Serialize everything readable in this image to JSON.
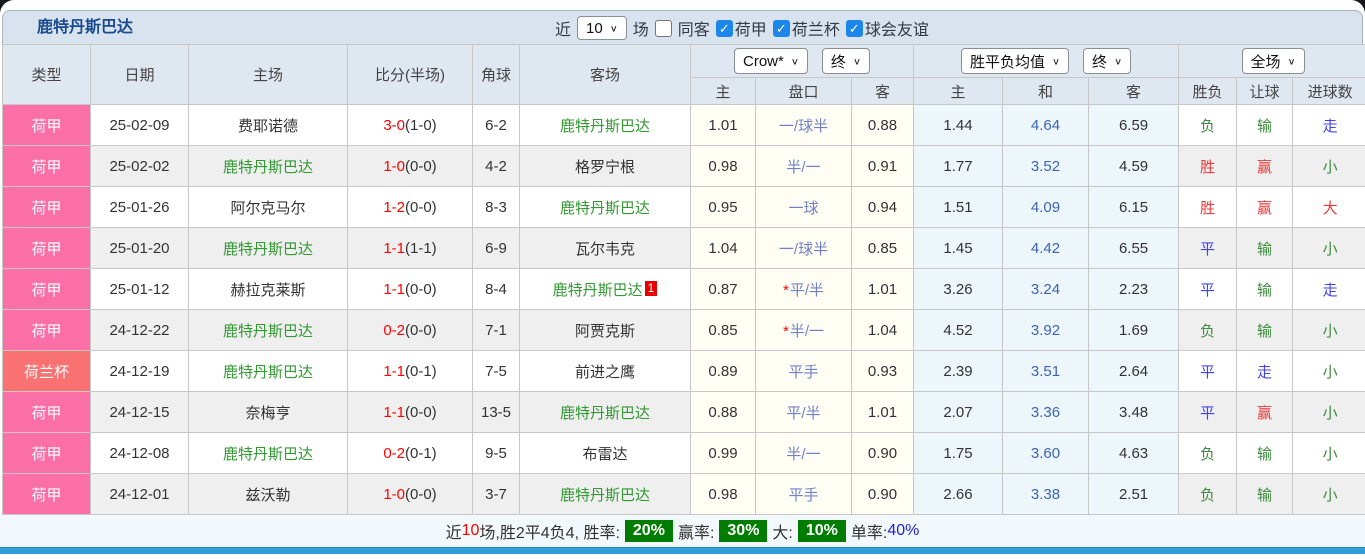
{
  "title": "鹿特丹斯巴达",
  "colors": {
    "league_cell": "#fa6fa5",
    "cup_cell": "#fa7171",
    "target_team_green": "#339933",
    "score_red": "#ff0000",
    "handicap_blue": "#7280c8",
    "avg_draw_blue": "#3c64b4",
    "win_red": "#e73b3b",
    "draw_blue": "#4343ee",
    "lose_green": "#3d8b3d",
    "badge_green": "#007d00",
    "bottom_bar_blue": "#2c9ed8",
    "header_bg": "#dfe7f0"
  },
  "controls": {
    "recent_label": "近",
    "recent_value": "10",
    "matches_label": "场",
    "same_venue_label": "同客",
    "same_venue_checked": false,
    "leagues": [
      {
        "label": "荷甲",
        "checked": true
      },
      {
        "label": "荷兰杯",
        "checked": true
      },
      {
        "label": "球会友谊",
        "checked": true
      }
    ]
  },
  "header": {
    "cols": [
      "类型",
      "日期",
      "主场",
      "比分(半场)",
      "角球",
      "客场"
    ],
    "odds_company_select": "Crow*",
    "odds_time_select": "终",
    "avg_select": "胜平负均值",
    "avg_time_select": "终",
    "period_select": "全场",
    "sub_cols": [
      "主",
      "盘口",
      "客",
      "主",
      "和",
      "客",
      "胜负",
      "让球",
      "进球数"
    ]
  },
  "rows": [
    {
      "league": "荷甲",
      "cup": false,
      "date": "25-02-09",
      "home": "费耶诺德",
      "home_target": false,
      "score": "3-0",
      "half": "(1-0)",
      "corners": "6-2",
      "away": "鹿特丹斯巴达",
      "away_target": true,
      "badge": null,
      "odds_home": "1.01",
      "handicap": "一/球半",
      "star": false,
      "odds_away": "0.88",
      "avg_home": "1.44",
      "avg_draw": "4.64",
      "avg_away": "6.59",
      "result": [
        "负",
        "green"
      ],
      "give": [
        "输",
        "green"
      ],
      "goals": [
        "走",
        "blue"
      ]
    },
    {
      "league": "荷甲",
      "cup": false,
      "date": "25-02-02",
      "home": "鹿特丹斯巴达",
      "home_target": true,
      "score": "1-0",
      "half": "(0-0)",
      "corners": "4-2",
      "away": "格罗宁根",
      "away_target": false,
      "badge": null,
      "odds_home": "0.98",
      "handicap": "半/一",
      "star": false,
      "odds_away": "0.91",
      "avg_home": "1.77",
      "avg_draw": "3.52",
      "avg_away": "4.59",
      "result": [
        "胜",
        "red"
      ],
      "give": [
        "赢",
        "red"
      ],
      "goals": [
        "小",
        "green"
      ]
    },
    {
      "league": "荷甲",
      "cup": false,
      "date": "25-01-26",
      "home": "阿尔克马尔",
      "home_target": false,
      "score": "1-2",
      "half": "(0-0)",
      "corners": "8-3",
      "away": "鹿特丹斯巴达",
      "away_target": true,
      "badge": null,
      "odds_home": "0.95",
      "handicap": "一球",
      "star": false,
      "odds_away": "0.94",
      "avg_home": "1.51",
      "avg_draw": "4.09",
      "avg_away": "6.15",
      "result": [
        "胜",
        "red"
      ],
      "give": [
        "赢",
        "red"
      ],
      "goals": [
        "大",
        "red"
      ]
    },
    {
      "league": "荷甲",
      "cup": false,
      "date": "25-01-20",
      "home": "鹿特丹斯巴达",
      "home_target": true,
      "score": "1-1",
      "half": "(1-1)",
      "corners": "6-9",
      "away": "瓦尔韦克",
      "away_target": false,
      "badge": null,
      "odds_home": "1.04",
      "handicap": "一/球半",
      "star": false,
      "odds_away": "0.85",
      "avg_home": "1.45",
      "avg_draw": "4.42",
      "avg_away": "6.55",
      "result": [
        "平",
        "blue"
      ],
      "give": [
        "输",
        "green"
      ],
      "goals": [
        "小",
        "green"
      ]
    },
    {
      "league": "荷甲",
      "cup": false,
      "date": "25-01-12",
      "home": "赫拉克莱斯",
      "home_target": false,
      "score": "1-1",
      "half": "(0-0)",
      "corners": "8-4",
      "away": "鹿特丹斯巴达",
      "away_target": true,
      "badge": "1",
      "odds_home": "0.87",
      "handicap": "平/半",
      "star": true,
      "odds_away": "1.01",
      "avg_home": "3.26",
      "avg_draw": "3.24",
      "avg_away": "2.23",
      "result": [
        "平",
        "blue"
      ],
      "give": [
        "输",
        "green"
      ],
      "goals": [
        "走",
        "blue"
      ]
    },
    {
      "league": "荷甲",
      "cup": false,
      "date": "24-12-22",
      "home": "鹿特丹斯巴达",
      "home_target": true,
      "score": "0-2",
      "half": "(0-0)",
      "corners": "7-1",
      "away": "阿贾克斯",
      "away_target": false,
      "badge": null,
      "odds_home": "0.85",
      "handicap": "半/一",
      "star": true,
      "odds_away": "1.04",
      "avg_home": "4.52",
      "avg_draw": "3.92",
      "avg_away": "1.69",
      "result": [
        "负",
        "green"
      ],
      "give": [
        "输",
        "green"
      ],
      "goals": [
        "小",
        "green"
      ]
    },
    {
      "league": "荷兰杯",
      "cup": true,
      "date": "24-12-19",
      "home": "鹿特丹斯巴达",
      "home_target": true,
      "score": "1-1",
      "half": "(0-1)",
      "corners": "7-5",
      "away": "前进之鹰",
      "away_target": false,
      "badge": null,
      "odds_home": "0.89",
      "handicap": "平手",
      "star": false,
      "odds_away": "0.93",
      "avg_home": "2.39",
      "avg_draw": "3.51",
      "avg_away": "2.64",
      "result": [
        "平",
        "blue"
      ],
      "give": [
        "走",
        "blue"
      ],
      "goals": [
        "小",
        "green"
      ]
    },
    {
      "league": "荷甲",
      "cup": false,
      "date": "24-12-15",
      "home": "奈梅亨",
      "home_target": false,
      "score": "1-1",
      "half": "(0-0)",
      "corners": "13-5",
      "away": "鹿特丹斯巴达",
      "away_target": true,
      "badge": null,
      "odds_home": "0.88",
      "handicap": "平/半",
      "star": false,
      "odds_away": "1.01",
      "avg_home": "2.07",
      "avg_draw": "3.36",
      "avg_away": "3.48",
      "result": [
        "平",
        "blue"
      ],
      "give": [
        "赢",
        "red"
      ],
      "goals": [
        "小",
        "green"
      ]
    },
    {
      "league": "荷甲",
      "cup": false,
      "date": "24-12-08",
      "home": "鹿特丹斯巴达",
      "home_target": true,
      "score": "0-2",
      "half": "(0-1)",
      "corners": "9-5",
      "away": "布雷达",
      "away_target": false,
      "badge": null,
      "odds_home": "0.99",
      "handicap": "半/一",
      "star": false,
      "odds_away": "0.90",
      "avg_home": "1.75",
      "avg_draw": "3.60",
      "avg_away": "4.63",
      "result": [
        "负",
        "green"
      ],
      "give": [
        "输",
        "green"
      ],
      "goals": [
        "小",
        "green"
      ]
    },
    {
      "league": "荷甲",
      "cup": false,
      "date": "24-12-01",
      "home": "兹沃勒",
      "home_target": false,
      "score": "1-0",
      "half": "(0-0)",
      "corners": "3-7",
      "away": "鹿特丹斯巴达",
      "away_target": true,
      "badge": null,
      "odds_home": "0.98",
      "handicap": "平手",
      "star": false,
      "odds_away": "0.90",
      "avg_home": "2.66",
      "avg_draw": "3.38",
      "avg_away": "2.51",
      "result": [
        "负",
        "green"
      ],
      "give": [
        "输",
        "green"
      ],
      "goals": [
        "小",
        "green"
      ]
    }
  ],
  "footer": {
    "segments": [
      {
        "text": "近",
        "style": "",
        "name": "footer-text"
      },
      {
        "text": "10",
        "style": "red",
        "name": "recent-count-value"
      },
      {
        "text": "场,胜2平4负4, 胜率:",
        "style": "",
        "name": "footer-text"
      },
      {
        "text": "20%",
        "style": "pct",
        "name": "win-rate-badge"
      },
      {
        "text": "赢率:",
        "style": "",
        "name": "footer-text"
      },
      {
        "text": "30%",
        "style": "pct",
        "name": "handicap-win-rate-badge"
      },
      {
        "text": "大:",
        "style": "",
        "name": "footer-text"
      },
      {
        "text": "10%",
        "style": "pct",
        "name": "over-rate-badge"
      },
      {
        "text": "单率:",
        "style": "",
        "name": "footer-text"
      },
      {
        "text": "40%",
        "style": "blue",
        "name": "odd-rate-value"
      }
    ]
  }
}
